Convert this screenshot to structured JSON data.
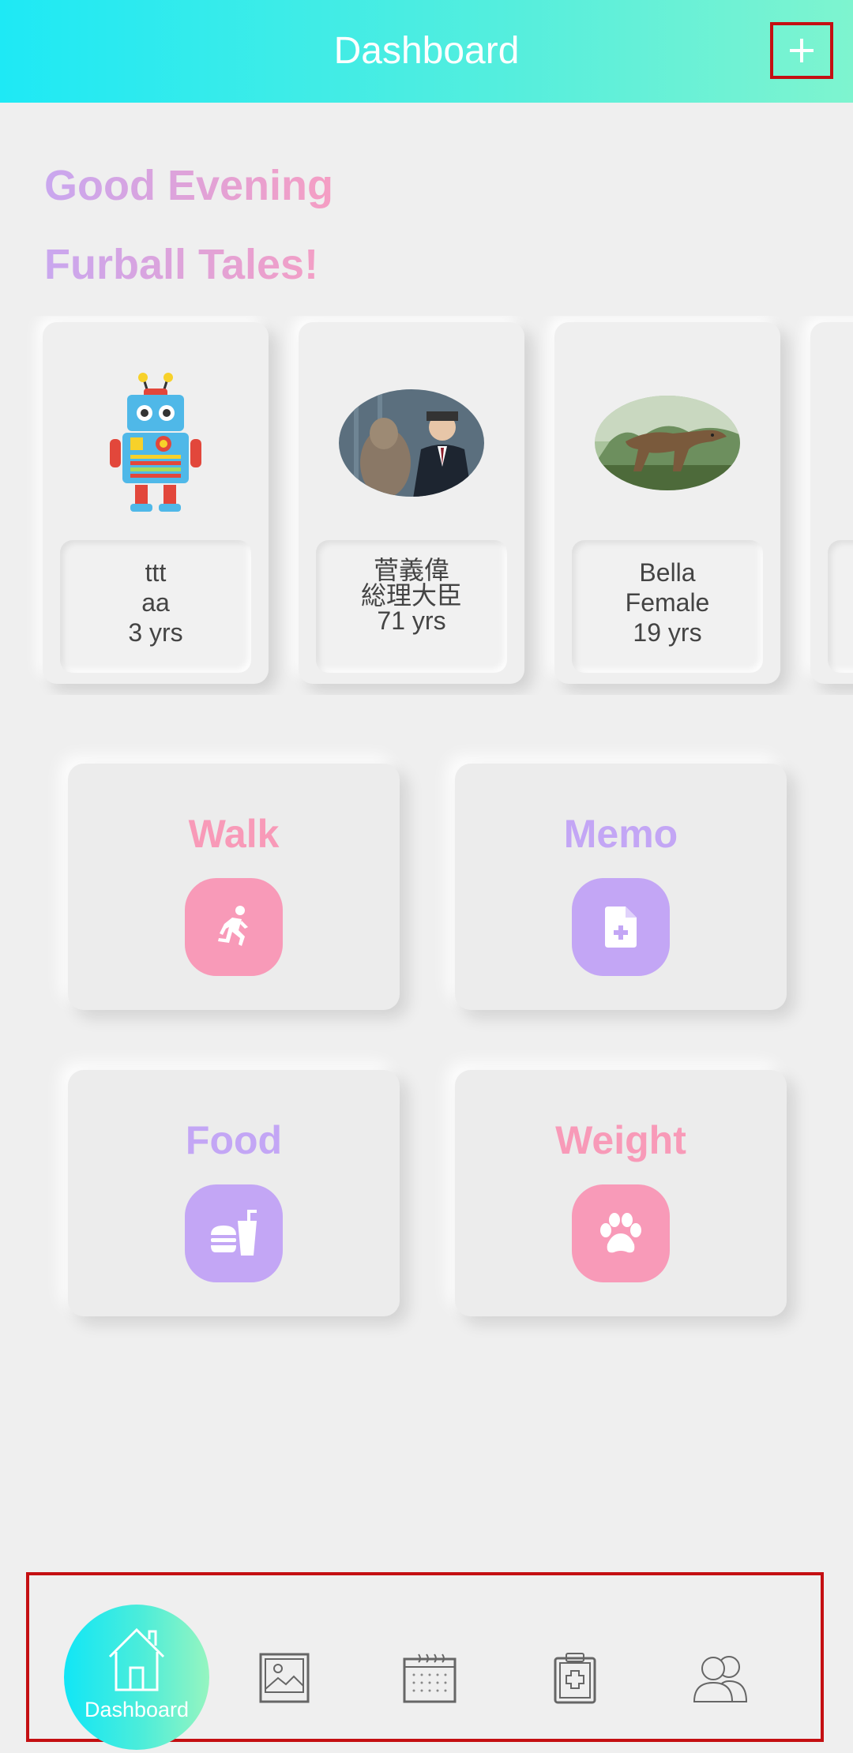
{
  "app_bar": {
    "title": "Dashboard",
    "add_label": "+"
  },
  "greeting": {
    "line1": "Good Evening",
    "line2": "Furball Tales!"
  },
  "pets": [
    {
      "line1": "ttt",
      "line2": "aa",
      "age": "3 yrs",
      "image": "robot-avatar"
    },
    {
      "line1": "菅義偉",
      "line2": "総理大臣",
      "age": "71 yrs",
      "image": "man-with-alpaca-photo"
    },
    {
      "line1": "Bella",
      "line2": "Female",
      "age": "19 yrs",
      "image": "t-rex-photo"
    }
  ],
  "actions": [
    {
      "label": "Walk",
      "icon": "running-person-icon",
      "color": "#f89ab8"
    },
    {
      "label": "Memo",
      "icon": "add-document-icon",
      "color": "#c3a6f5"
    },
    {
      "label": "Food",
      "icon": "burger-drink-icon",
      "color": "#c3a6f5"
    },
    {
      "label": "Weight",
      "icon": "paw-icon",
      "color": "#f89ab8"
    }
  ],
  "bottom_nav": {
    "active_label": "Dashboard",
    "items": [
      "home-icon",
      "gallery-icon",
      "calendar-icon",
      "medical-record-icon",
      "users-icon"
    ]
  },
  "colors": {
    "header_start": "#1ee9f5",
    "header_end": "#7ef4cf",
    "pink": "#f89ab8",
    "purple": "#c3a6f5",
    "highlight": "#c40f12"
  }
}
